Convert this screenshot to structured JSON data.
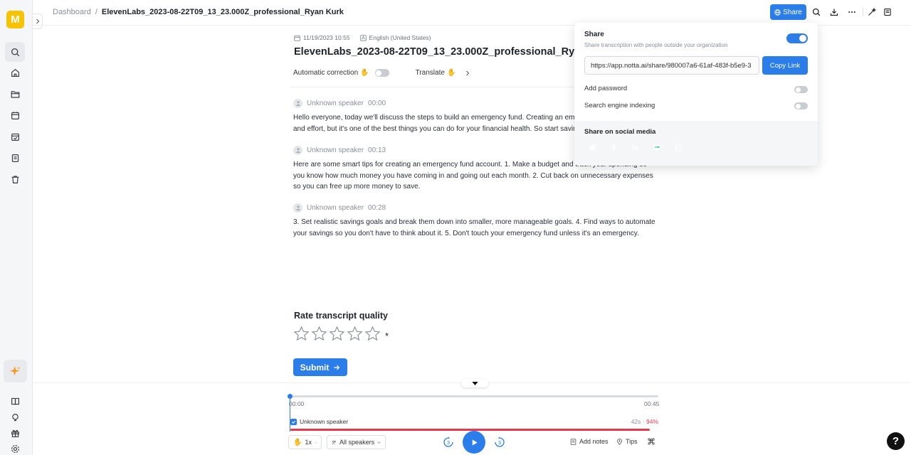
{
  "app": {
    "logo_letter": "M"
  },
  "breadcrumb": {
    "root": "Dashboard",
    "separator": "/",
    "current": "ElevenLabs_2023-08-22T09_13_23.000Z_professional_Ryan Kurk"
  },
  "toolbar": {
    "share_label": "Share"
  },
  "doc": {
    "date": "11/19/2023 10:55",
    "language": "English (United States)",
    "title": "ElevenLabs_2023-08-22T09_13_23.000Z_professional_Ryan Kurk",
    "auto_correction_label": "Automatic correction",
    "auto_correction_on": false,
    "translate_label": "Translate"
  },
  "segments": [
    {
      "speaker": "Unknown speaker",
      "time": "00:00",
      "text": "Hello everyone, today we'll discuss the steps to build an emergency fund. Creating an emergency fund takes time and effort, but it's one of the best things you can do for your financial health. So start saving today."
    },
    {
      "speaker": "Unknown speaker",
      "time": "00:13",
      "text": "Here are some smart tips for creating an emergency fund account. 1. Make a budget and track your spending so you know how much money you have coming in and going out each month. 2. Cut back on unnecessary expenses so you can free up more money to save."
    },
    {
      "speaker": "Unknown speaker",
      "time": "00:28",
      "text": "3. Set realistic savings goals and break them down into smaller, more manageable goals. 4. Find ways to automate your savings so you don't have to think about it. 5. Don't touch your emergency fund unless it's an emergency."
    }
  ],
  "rating": {
    "title": "Rate transcript quality",
    "stars_total": 5,
    "stars_filled": 0,
    "required_mark": "*",
    "submit_label": "Submit"
  },
  "player": {
    "current_time": "00:00",
    "total_time": "00:45",
    "progress": 0,
    "speaker_label": "Unknown speaker",
    "speaker_duration": "42s",
    "speaker_sep": " · ",
    "speaker_percent": "94%",
    "speaker_share": 0.94,
    "speed": "1x",
    "speakers_filter": "All speakers",
    "skip_back": "3",
    "skip_forward": "3",
    "add_notes": "Add notes",
    "tips": "Tips",
    "help": "?"
  },
  "share_panel": {
    "title": "Share",
    "subtitle": "Share transcription with people outside your organization",
    "enabled": true,
    "link": "https://app.notta.ai/share/980007a6-61af-483f-b5e9-3",
    "copy_label": "Copy Link",
    "add_password_label": "Add password",
    "add_password_on": false,
    "indexing_label": "Search engine indexing",
    "indexing_on": false,
    "social_title": "Share on social media",
    "social": [
      {
        "name": "twitter",
        "color": "#1d9bf0"
      },
      {
        "name": "facebook",
        "color": "#3b5998"
      },
      {
        "name": "linkedin",
        "color": "#0a66c2"
      },
      {
        "name": "line",
        "color": "#06c755",
        "glyph": "LINE"
      },
      {
        "name": "whatsapp",
        "color": "#25d366"
      }
    ]
  },
  "colors": {
    "accent": "#2b7de9",
    "alert": "#e8384f",
    "logo": "#f7c200"
  }
}
